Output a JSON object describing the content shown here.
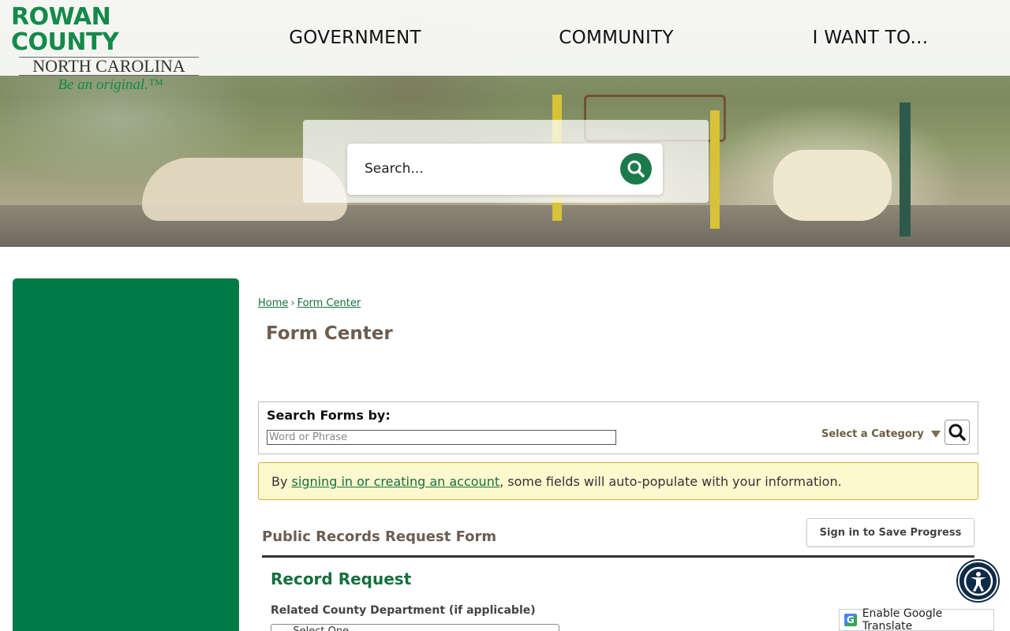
{
  "header": {
    "logo": {
      "line1": "ROWAN COUNTY",
      "line2": "NORTH CAROLINA",
      "line3": "Be an original.™"
    },
    "nav": [
      "GOVERNMENT",
      "COMMUNITY",
      "I WANT TO..."
    ]
  },
  "hero_search": {
    "placeholder": "Search..."
  },
  "breadcrumb": {
    "home": "Home",
    "separator": "›",
    "current": "Form Center"
  },
  "page_title": "Form Center",
  "search_forms": {
    "label": "Search Forms by:",
    "placeholder": "Word or Phrase",
    "category": "Select a Category"
  },
  "notice": {
    "prefix": "By ",
    "link": "signing in or creating an account",
    "suffix": ", some fields will auto-populate with your information."
  },
  "form": {
    "title": "Public Records Request Form",
    "save_label": "Sign in to Save Progress",
    "section": "Record Request",
    "field_label": "Related County Department (if applicable)",
    "field_value": "--Select One--"
  },
  "translate_label": "Enable Google Translate",
  "colors": {
    "brand_green": "#007a47",
    "link_green": "#156f3e",
    "notice_bg": "#fdf8ce",
    "a11y_navy": "#0f2a47"
  }
}
